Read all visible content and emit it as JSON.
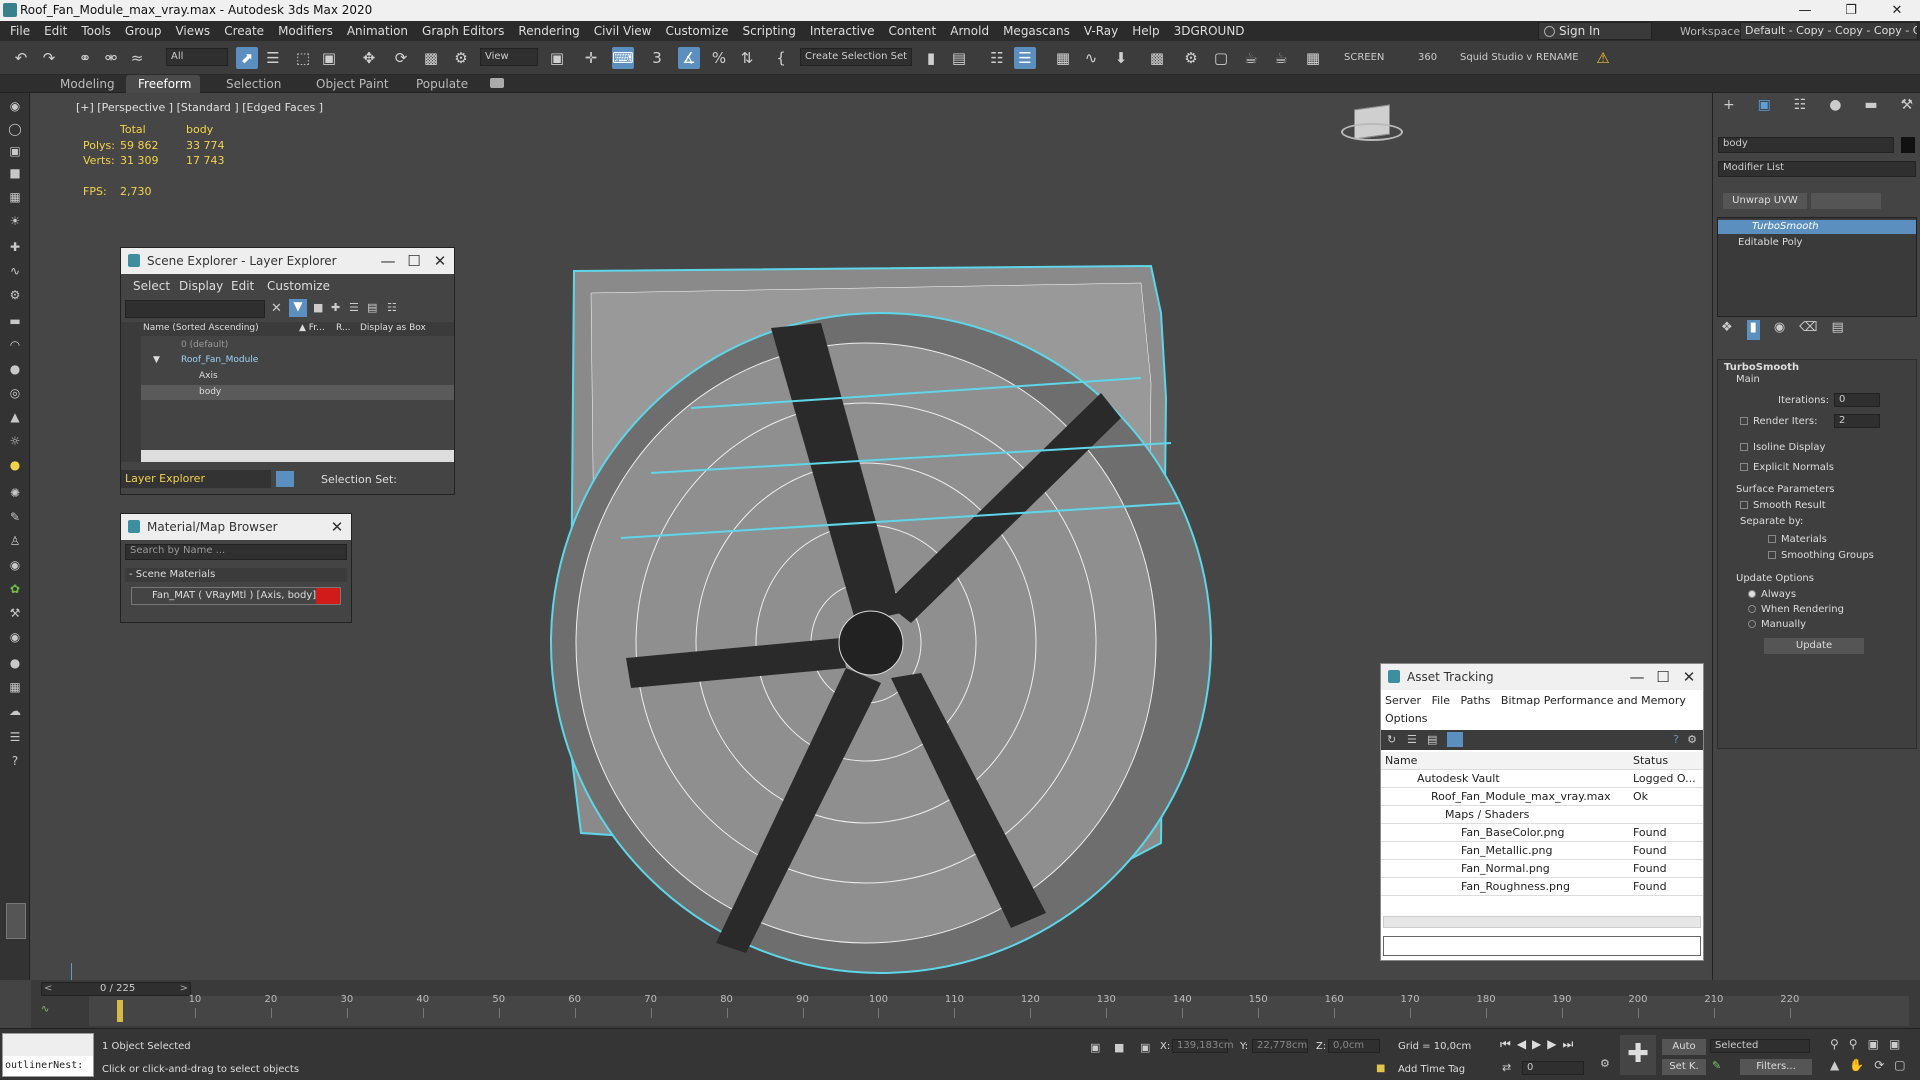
{
  "window": {
    "title": "Roof_Fan_Module_max_vray.max - Autodesk 3ds Max 2020"
  },
  "menu": [
    "File",
    "Edit",
    "Tools",
    "Group",
    "Views",
    "Create",
    "Modifiers",
    "Animation",
    "Graph Editors",
    "Rendering",
    "Civil View",
    "Customize",
    "Scripting",
    "Interactive",
    "Content",
    "Arnold",
    "Megascans",
    "V-Ray",
    "Help",
    "3DGROUND"
  ],
  "signin": "Sign In",
  "workspaces": {
    "label": "Workspaces:",
    "value": "Default - Copy - Copy - Copy - Copy"
  },
  "toolbar": {
    "filter": "All",
    "view": "View",
    "selection_set": "Create Selection Set",
    "screen": "SCREEN",
    "value_360": "360",
    "squid": "Squid Studio v",
    "rename": "RENAME"
  },
  "ribbon": [
    "Modeling",
    "Freeform",
    "Selection",
    "Object Paint",
    "Populate"
  ],
  "viewport": {
    "label": "[+] [Perspective ] [Standard ] [Edged Faces ]",
    "stats": {
      "h_total": "Total",
      "h_body": "body",
      "polys_label": "Polys:",
      "polys_total": "59 862",
      "polys_body": "33 774",
      "verts_label": "Verts:",
      "verts_total": "31 309",
      "verts_body": "17 743",
      "fps_label": "FPS:",
      "fps_value": "2,730"
    }
  },
  "scene_explorer": {
    "title": "Scene Explorer - Layer Explorer",
    "menu": [
      "Select",
      "Display",
      "Edit",
      "Customize"
    ],
    "col_name": "Name (Sorted Ascending)",
    "col_fr": "▲ Fr...",
    "col_r": "R...",
    "col_box": "Display as Box",
    "rows": [
      "0 (default)",
      "Roof_Fan_Module",
      "Axis",
      "body"
    ],
    "footer_left": "Layer Explorer",
    "footer_right": "Selection Set:"
  },
  "material_browser": {
    "title": "Material/Map Browser",
    "search_placeholder": "Search by Name ...",
    "section": "- Scene Materials",
    "item": "Fan_MAT  ( VRayMtl )  [Axis, body]",
    "swatch_color": "#d11a1a"
  },
  "asset_tracking": {
    "title": "Asset Tracking",
    "menu": [
      "Server",
      "File",
      "Paths",
      "Bitmap Performance and Memory"
    ],
    "menu2": "Options",
    "col_name": "Name",
    "col_status": "Status",
    "rows": [
      {
        "name": "Autodesk Vault",
        "status": "Logged O..."
      },
      {
        "name": "Roof_Fan_Module_max_vray.max",
        "status": "Ok"
      },
      {
        "name": "Maps / Shaders",
        "status": ""
      },
      {
        "name": "Fan_BaseColor.png",
        "status": "Found"
      },
      {
        "name": "Fan_Metallic.png",
        "status": "Found"
      },
      {
        "name": "Fan_Normal.png",
        "status": "Found"
      },
      {
        "name": "Fan_Roughness.png",
        "status": "Found"
      }
    ]
  },
  "command_panel": {
    "object_name": "body",
    "object_color": "#111111",
    "modifier_list": "Modifier List",
    "unwrap": "Unwrap UVW",
    "stack": [
      "TurboSmooth",
      "Editable Poly"
    ],
    "rollout": "TurboSmooth",
    "main": "Main",
    "iterations_label": "Iterations:",
    "iterations_value": "0",
    "render_iters_label": "Render Iters:",
    "render_iters_value": "2",
    "isoline": "Isoline Display",
    "explicit": "Explicit Normals",
    "surface_params": "Surface Parameters",
    "smooth_result": "Smooth Result",
    "separate_by": "Separate by:",
    "materials": "Materials",
    "smoothing_groups": "Smoothing Groups",
    "update_options": "Update Options",
    "always": "Always",
    "when_rendering": "When Rendering",
    "manually": "Manually",
    "update_btn": "Update"
  },
  "timeline": {
    "slider": "0 / 225",
    "ticks": [
      "10",
      "20",
      "30",
      "40",
      "50",
      "60",
      "70",
      "80",
      "90",
      "100",
      "110",
      "120",
      "130",
      "140",
      "150",
      "160",
      "170",
      "180",
      "190",
      "200",
      "210",
      "220"
    ]
  },
  "status": {
    "script_box": "outlinerNest:",
    "selected": "1 Object Selected",
    "prompt": "Click or click-and-drag to select objects",
    "x_label": "X:",
    "x_value": "139,183cm",
    "y_label": "Y:",
    "y_value": "22,778cm",
    "z_label": "Z:",
    "z_value": "0,0cm",
    "grid": "Grid = 10,0cm",
    "add_time_tag": "Add Time Tag",
    "auto": "Auto",
    "set_key": "Set K.",
    "selected_drop": "Selected",
    "filters": "Filters...",
    "frame": "0"
  }
}
